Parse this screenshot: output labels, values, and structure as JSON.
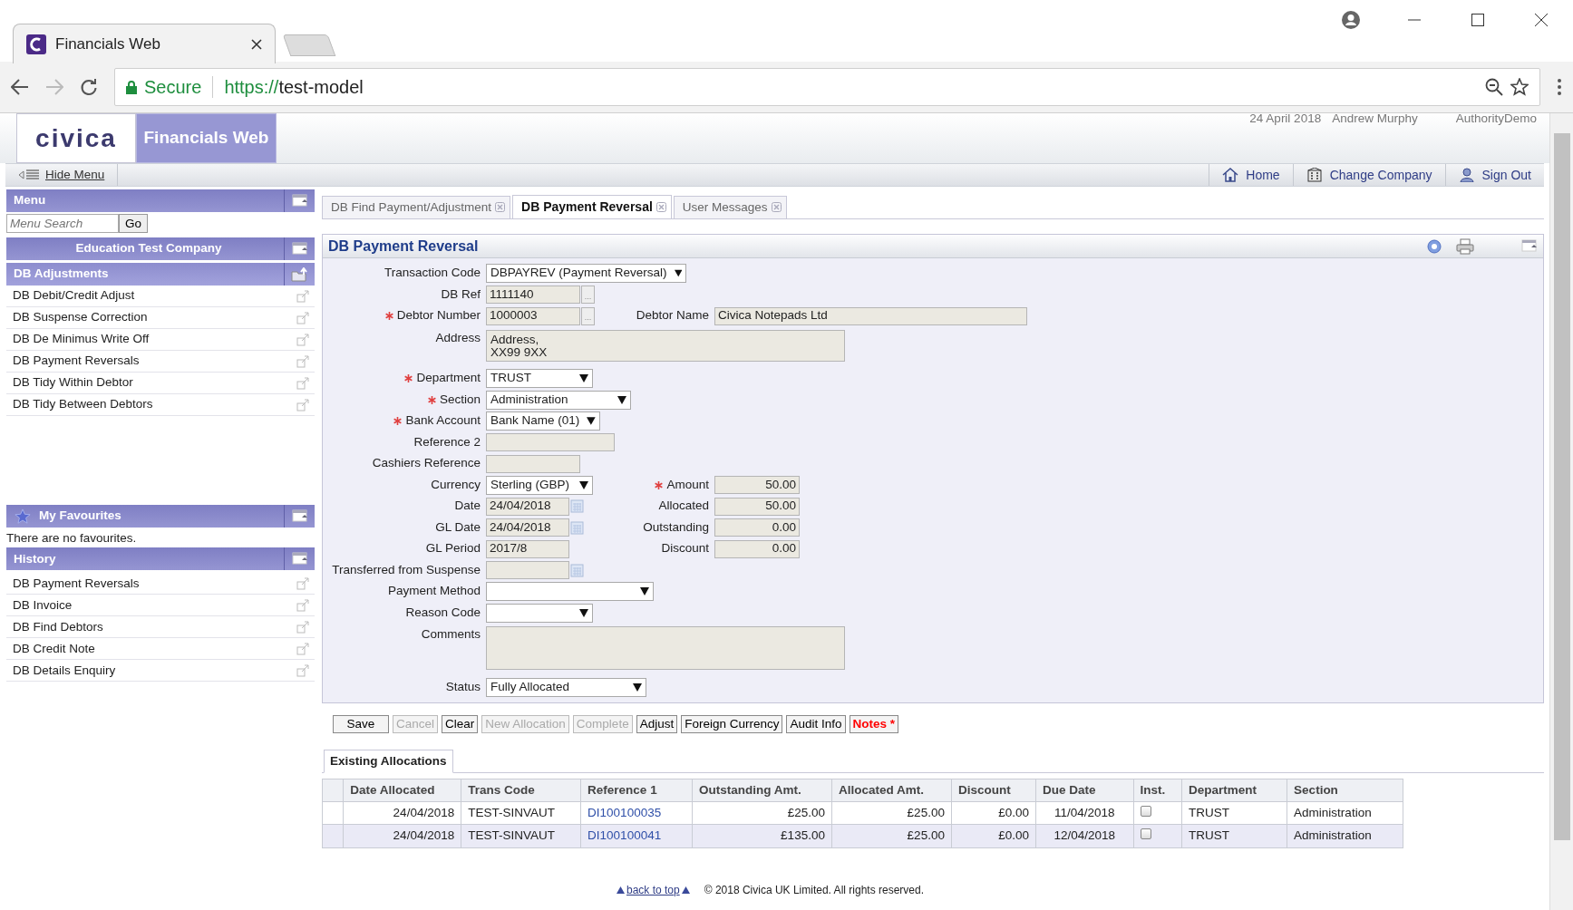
{
  "browser": {
    "tab_title": "Financials Web",
    "secure_label": "Secure",
    "url_scheme": "https://",
    "url_host": "test-model"
  },
  "header": {
    "logo": "civica",
    "app_name": "Financials Web",
    "date": "24 April 2018",
    "user": "Andrew Murphy",
    "authority": "AuthorityDemo"
  },
  "toolbar": {
    "hide_menu": "Hide Menu",
    "links": [
      {
        "label": "Home",
        "kind": "home"
      },
      {
        "label": "Change Company",
        "kind": "building"
      },
      {
        "label": "Sign Out",
        "kind": "user"
      }
    ]
  },
  "sidebar": {
    "menu_title": "Menu",
    "search_placeholder": "Menu Search",
    "go": "Go",
    "company": "Education Test Company",
    "adjustments": {
      "title": "DB Adjustments",
      "items": [
        "DB Debit/Credit Adjust",
        "DB Suspense Correction",
        "DB De Minimus Write Off",
        "DB Payment Reversals",
        "DB Tidy Within Debtor",
        "DB Tidy Between Debtors"
      ]
    },
    "favourites": {
      "title": "My Favourites",
      "empty_text": "There are no favourites."
    },
    "history": {
      "title": "History",
      "items": [
        "DB Payment Reversals",
        "DB Invoice",
        "DB Find Debtors",
        "DB Credit Note",
        "DB Details Enquiry"
      ]
    }
  },
  "tabs": [
    {
      "label": "DB Find Payment/Adjustment",
      "selected": false
    },
    {
      "label": "DB Payment Reversal",
      "selected": true
    },
    {
      "label": "User Messages",
      "selected": false
    }
  ],
  "form": {
    "title": "DB Payment Reversal",
    "rows": [
      {
        "label": "Transaction Code",
        "required": false,
        "kind": "select",
        "value": "DBPAYREV (Payment Reversal)"
      },
      {
        "label": "DB Ref",
        "required": false,
        "kind": "lookup",
        "value": "1111140",
        "button": "..."
      },
      {
        "label": "Debtor Number",
        "required": true,
        "kind": "lookup",
        "value": "1000003",
        "button": "...",
        "right": {
          "label": "Debtor Name",
          "required": false,
          "kind": "text",
          "value": "Civica Notepads Ltd"
        }
      },
      {
        "label": "Address",
        "required": false,
        "kind": "textarea",
        "value": "Address,\nXX99 9XX"
      },
      {
        "label": "Department",
        "required": true,
        "kind": "select",
        "value": "TRUST"
      },
      {
        "label": "Section",
        "required": true,
        "kind": "select",
        "value": "Administration"
      },
      {
        "label": "Bank Account",
        "required": true,
        "kind": "select",
        "value": "Bank Name (01)"
      },
      {
        "label": "Reference 2",
        "required": false,
        "kind": "text"
      },
      {
        "label": "Cashiers Reference",
        "required": false,
        "kind": "text"
      },
      {
        "label": "Currency",
        "required": false,
        "kind": "select",
        "value": "Sterling (GBP)",
        "right": {
          "label": "Amount",
          "required": true,
          "kind": "number",
          "value": "50.00"
        }
      },
      {
        "label": "Date",
        "required": false,
        "kind": "date",
        "value": "24/04/2018",
        "right": {
          "label": "Allocated",
          "required": false,
          "kind": "number",
          "value": "50.00"
        }
      },
      {
        "label": "GL Date",
        "required": false,
        "kind": "date",
        "value": "24/04/2018",
        "right": {
          "label": "Outstanding",
          "required": false,
          "kind": "number",
          "value": "0.00"
        }
      },
      {
        "label": "GL Period",
        "required": false,
        "kind": "text",
        "value": "2017/8",
        "right": {
          "label": "Discount",
          "required": false,
          "kind": "number",
          "value": "0.00"
        }
      },
      {
        "label": "Transferred from Suspense",
        "required": false,
        "kind": "date"
      },
      {
        "label": "Payment Method",
        "required": false,
        "kind": "select"
      },
      {
        "label": "Reason Code",
        "required": false,
        "kind": "select"
      },
      {
        "label": "Comments",
        "required": false,
        "kind": "textarea"
      },
      {
        "label": "Status",
        "required": false,
        "kind": "select",
        "value": "Fully Allocated"
      }
    ]
  },
  "buttons": [
    {
      "label": "Save",
      "disabled": false,
      "alert": false
    },
    {
      "label": "Cancel",
      "disabled": true,
      "alert": false
    },
    {
      "label": "Clear",
      "disabled": false,
      "alert": false
    },
    {
      "label": "New Allocation",
      "disabled": true,
      "alert": false
    },
    {
      "label": "Complete",
      "disabled": true,
      "alert": false
    },
    {
      "label": "Adjust",
      "disabled": false,
      "alert": false
    },
    {
      "label": "Foreign Currency",
      "disabled": false,
      "alert": false
    },
    {
      "label": "Audit Info",
      "disabled": false,
      "alert": false
    },
    {
      "label": "Notes *",
      "disabled": false,
      "alert": true
    }
  ],
  "allocations": {
    "tab": "Existing Allocations",
    "columns": [
      "Date Allocated",
      "Trans Code",
      "Reference 1",
      "Outstanding Amt.",
      "Allocated Amt.",
      "Discount",
      "Due Date",
      "Inst.",
      "Department",
      "Section"
    ],
    "rows": [
      {
        "date_allocated": "24/04/2018",
        "trans_code": "TEST-SINVAUT",
        "reference_1": "DI100100035",
        "outstanding": "£25.00",
        "allocated": "£25.00",
        "discount": "£0.00",
        "due_date": "11/04/2018",
        "inst": false,
        "department": "TRUST",
        "section": "Administration"
      },
      {
        "date_allocated": "24/04/2018",
        "trans_code": "TEST-SINVAUT",
        "reference_1": "DI100100041",
        "outstanding": "£135.00",
        "allocated": "£25.00",
        "discount": "£0.00",
        "due_date": "12/04/2018",
        "inst": false,
        "department": "TRUST",
        "section": "Administration"
      }
    ]
  },
  "footer": {
    "back_to_top": "back to top",
    "copyright": "© 2018 Civica UK Limited. All rights reserved."
  }
}
